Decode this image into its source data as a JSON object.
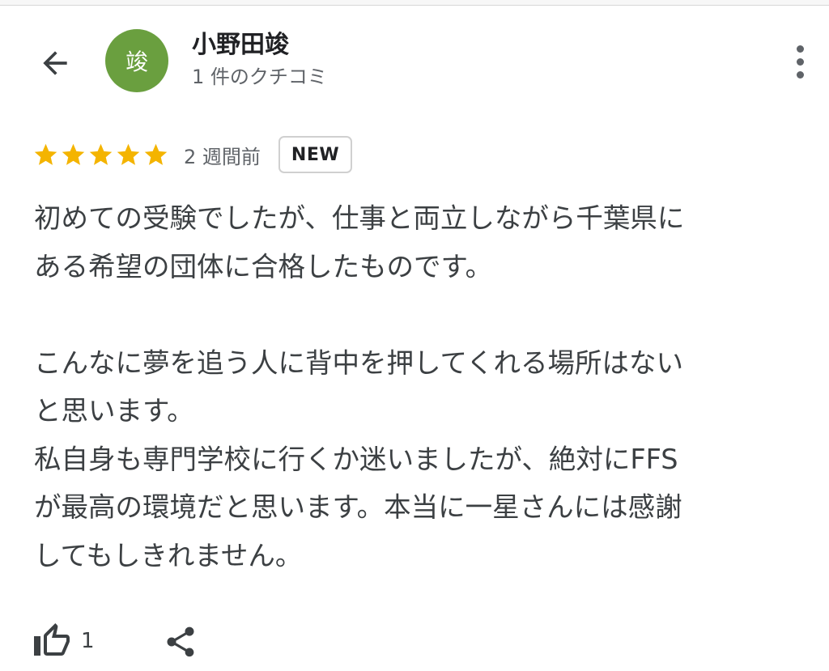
{
  "header": {
    "back_icon": "arrow-left-icon",
    "avatar": {
      "initial": "竣",
      "color": "#6a9f3f"
    },
    "author_name": "小野田竣",
    "review_count": "1 件のクチコミ",
    "more_icon": "more-vertical-icon"
  },
  "review": {
    "rating": 5,
    "rating_max": 5,
    "star_color": "#f4b400",
    "relative_time": "2 週間前",
    "badge": "NEW",
    "lines": [
      "初めての受験でしたが、仕事と両立しながら千葉県に",
      "ある希望の団体に合格したものです。",
      "",
      "こんなに夢を追う人に背中を押してくれる場所はない",
      "と思います。",
      "私自身も専門学校に行くか迷いましたが、絶対にFFS",
      "が最高の環境だと思います。本当に一星さんには感謝",
      "してもしきれません。"
    ]
  },
  "actions": {
    "like_icon": "thumbs-up-icon",
    "like_count": "1",
    "share_icon": "share-icon"
  }
}
